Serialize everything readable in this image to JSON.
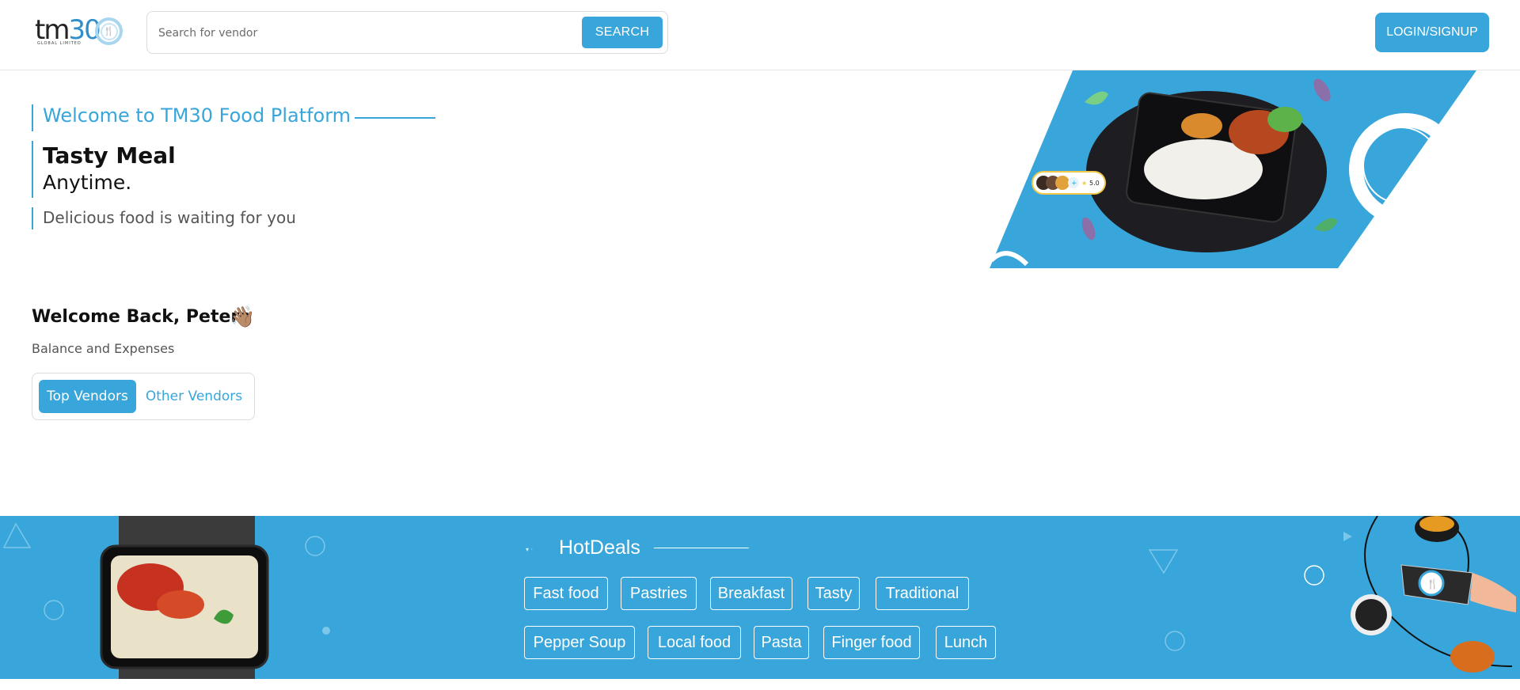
{
  "header": {
    "logo_text": "tm",
    "logo_num": "30",
    "logo_sub": "GLOBAL LIMITED",
    "search": {
      "placeholder": "Search for vendor",
      "button_label": "SEARCH"
    },
    "login_label": "LOGIN/SIGNUP"
  },
  "hero": {
    "welcome": "Welcome to TM30 Food Platform",
    "title": "Tasty Meal",
    "subtitle": "Anytime.",
    "tagline": "Delicious food is waiting for you",
    "rating": "5.0",
    "rating_plus": "+"
  },
  "user": {
    "greeting": "Welcome Back, Peters",
    "wave_emoji": "👋🏽",
    "balance_label": "Balance and Expenses"
  },
  "tabs": [
    {
      "label": "Top Vendors",
      "active": true
    },
    {
      "label": "Other Vendors",
      "active": false
    }
  ],
  "hot_deals": {
    "title": "HotDeals",
    "categories": [
      "Fast food",
      "Pastries",
      "Breakfast",
      "Tasty",
      "Traditional",
      "Pepper Soup",
      "Local food",
      "Pasta",
      "Finger food",
      "Lunch"
    ]
  },
  "colors": {
    "accent": "#38a6da",
    "banner": "#38a6da",
    "text": "#111111"
  }
}
